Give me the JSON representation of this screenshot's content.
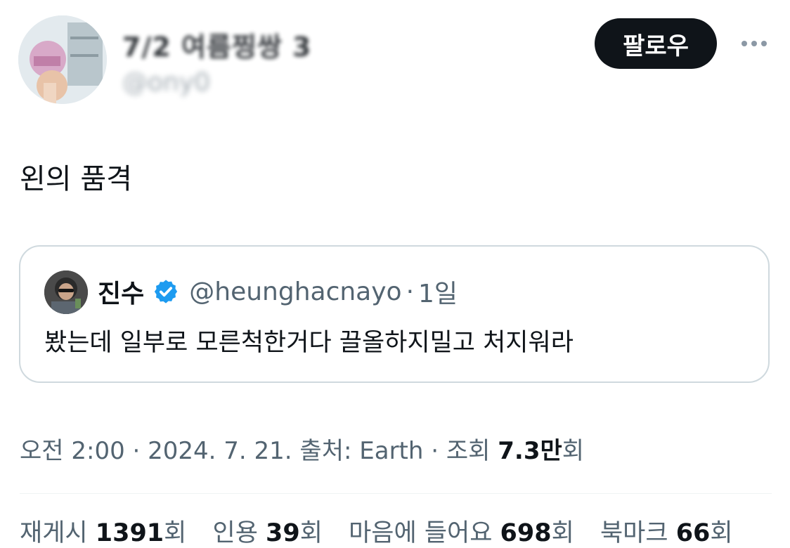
{
  "author": {
    "display_name": "7/2 여름찡쌍 3",
    "handle": "@ony0"
  },
  "header": {
    "follow_label": "팔로우",
    "more_icon": "more-horizontal-icon"
  },
  "tweet": {
    "text": "왼의 품격"
  },
  "quote": {
    "name": "진수",
    "verified_icon": "verified-badge-icon",
    "verified_color": "#1d9bf0",
    "handle": "@heunghacnayo",
    "separator": "·",
    "time": "1일",
    "text": "봤는데 일부로 모른척한거다 끌올하지밀고 처지워라"
  },
  "meta": {
    "time": "오전 2:00",
    "sep1": " · ",
    "date": "2024. 7. 21.",
    "source_prefix": " 출처: ",
    "source": "Earth",
    "sep2": " · ",
    "views_prefix": "조회 ",
    "views_value": "7.3만",
    "views_suffix": "회"
  },
  "stats": [
    {
      "label": "재게시 ",
      "value": "1391",
      "suffix": "회"
    },
    {
      "label": "인용 ",
      "value": "39",
      "suffix": "회"
    },
    {
      "label": "마음에 들어요 ",
      "value": "698",
      "suffix": "회"
    },
    {
      "label": "북마크 ",
      "value": "66",
      "suffix": "회"
    }
  ],
  "colors": {
    "text_primary": "#0f1419",
    "text_secondary": "#536471",
    "border": "#cfd9de",
    "button_bg": "#0f1419",
    "verified": "#1d9bf0"
  }
}
